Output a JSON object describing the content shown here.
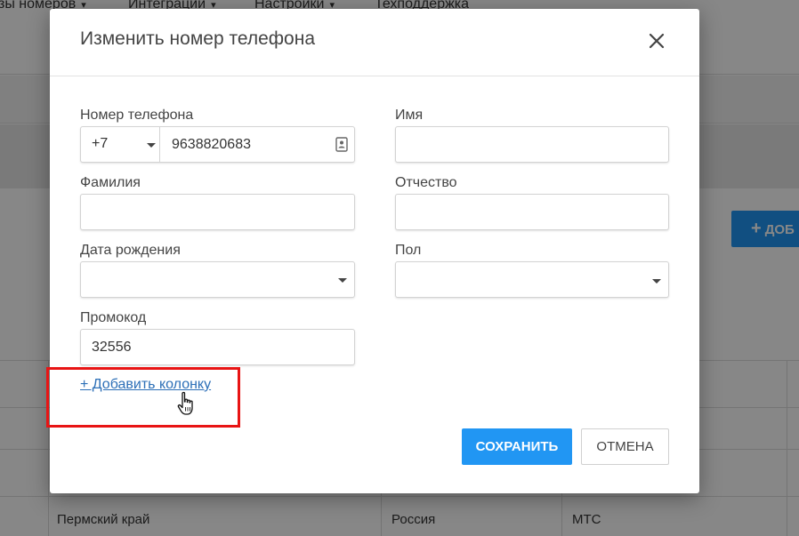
{
  "background": {
    "nav": [
      {
        "label": "зы номеров"
      },
      {
        "label": "Интеграции"
      },
      {
        "label": "Настройки"
      },
      {
        "label": "Техподдержка"
      }
    ],
    "add_button_label": "ДОБ",
    "table_row": {
      "region": "Пермский край",
      "country": "Россия",
      "operator": "МТС"
    }
  },
  "modal": {
    "title": "Изменить номер телефона",
    "fields": {
      "phone": {
        "label": "Номер телефона",
        "code": "+7",
        "value": "9638820683"
      },
      "first_name": {
        "label": "Имя",
        "value": ""
      },
      "last_name": {
        "label": "Фамилия",
        "value": ""
      },
      "middle_name": {
        "label": "Отчество",
        "value": ""
      },
      "birth_date": {
        "label": "Дата рождения",
        "value": ""
      },
      "gender": {
        "label": "Пол",
        "value": ""
      },
      "promo_code": {
        "label": "Промокод",
        "value": "32556"
      }
    },
    "add_column_link": "+ Добавить колонку",
    "save_label": "СОХРАНИТЬ",
    "cancel_label": "ОТМЕНА"
  },
  "colors": {
    "primary": "#2196f3",
    "link": "#2c6fb7",
    "highlight": "#e81414",
    "overlay": "rgba(0,0,0,0.47)"
  },
  "icons": [
    "close-icon",
    "chevron-down-icon",
    "contact-card-icon",
    "hand-pointer-cursor-icon",
    "plus-icon"
  ]
}
